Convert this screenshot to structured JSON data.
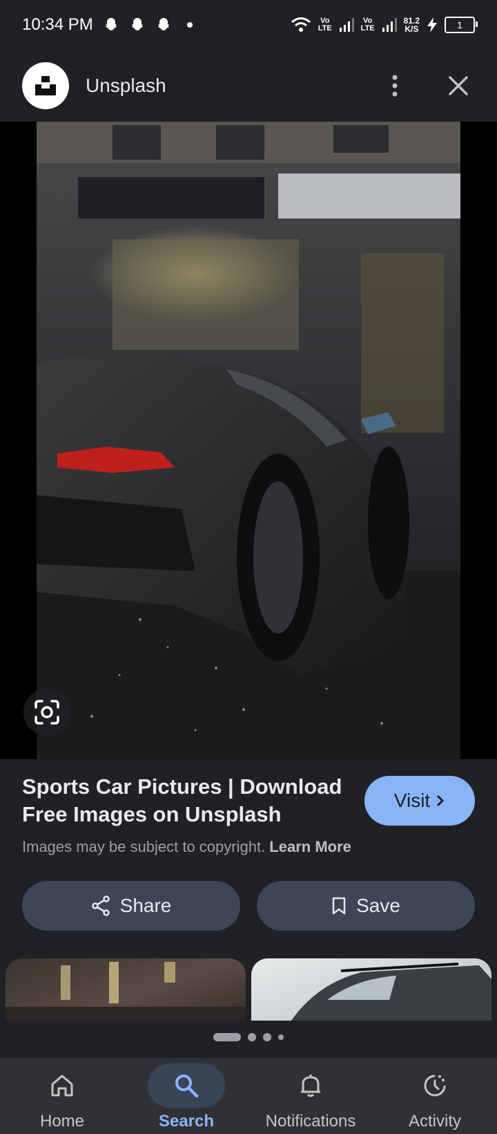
{
  "status_bar": {
    "time": "10:34 PM",
    "net1_top": "Vo",
    "net1_bottom": "LTE",
    "net2_top": "Vo",
    "net2_bottom": "LTE",
    "speed_value": "81.2",
    "speed_unit": "K/S",
    "battery": "1",
    "notification_icons": [
      "snapchat-icon",
      "snapchat-icon",
      "snapchat-icon"
    ]
  },
  "top_bar": {
    "site_name": "Unsplash"
  },
  "result": {
    "title": "Sports Car Pictures | Download Free Images on Unsplash",
    "visit_label": "Visit",
    "copyright_text": "Images may be subject to copyright.",
    "learn_more": "Learn More"
  },
  "actions": {
    "share_label": "Share",
    "save_label": "Save"
  },
  "pager": {
    "total": 4,
    "active_index": 0
  },
  "bottom_nav": {
    "items": [
      {
        "label": "Home",
        "icon": "home-icon",
        "active": false
      },
      {
        "label": "Search",
        "icon": "search-icon",
        "active": true
      },
      {
        "label": "Notifications",
        "icon": "bell-icon",
        "active": false
      },
      {
        "label": "Activity",
        "icon": "activity-icon",
        "active": false
      }
    ]
  },
  "colors": {
    "background": "#202124",
    "accent": "#8ab4f8",
    "pill": "#3c4658",
    "nav_bg": "#303134"
  }
}
